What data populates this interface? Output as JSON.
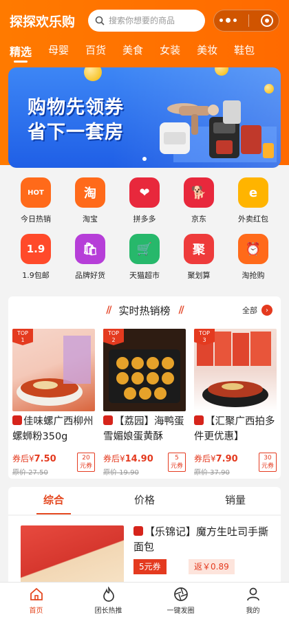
{
  "header": {
    "app_title": "探探欢乐购",
    "search_placeholder": "搜索你想要的商品",
    "tabs": [
      "精选",
      "母婴",
      "百货",
      "美食",
      "女装",
      "美妆",
      "鞋包"
    ],
    "active_tab": 0
  },
  "banner": {
    "line1": "购物先领券",
    "line2": "省下一套房"
  },
  "grid": [
    {
      "label": "今日热销",
      "icon": "hot-icon",
      "glyph": "HOT",
      "color": "#ff6a1a"
    },
    {
      "label": "淘宝",
      "icon": "taobao-icon",
      "glyph": "淘",
      "color": "#ff6a1a"
    },
    {
      "label": "拼多多",
      "icon": "pinduoduo-icon",
      "glyph": "❤",
      "color": "#e8283c"
    },
    {
      "label": "京东",
      "icon": "jd-icon",
      "glyph": "🐕",
      "color": "#e8283c"
    },
    {
      "label": "外卖红包",
      "icon": "takeout-icon",
      "glyph": "e",
      "color": "#ffb400"
    },
    {
      "label": "1.9包邮",
      "icon": "free-shipping-icon",
      "glyph": "1.9",
      "color": "#ff4a2a"
    },
    {
      "label": "品牌好货",
      "icon": "brand-bag-icon",
      "glyph": "🛍",
      "color": "#b63ed8"
    },
    {
      "label": "天猫超市",
      "icon": "tmall-market-icon",
      "glyph": "🛒",
      "color": "#27b86b"
    },
    {
      "label": "聚划算",
      "icon": "juhuasuan-icon",
      "glyph": "聚",
      "color": "#ee3b3b"
    },
    {
      "label": "淘抢购",
      "icon": "alarm-clock-icon",
      "glyph": "⏰",
      "color": "#ff6a1a"
    }
  ],
  "hot": {
    "title": "实时热销榜",
    "all_label": "全部",
    "items": [
      {
        "rank_text": "TOP",
        "rank": "1",
        "title": "佳味螺广西柳州螺蛳粉350g",
        "price_prefix": "券后¥",
        "price": "7.50",
        "old_price": "原价 27.50",
        "coupon_amount": "20",
        "coupon_unit": "元券",
        "img_colors": [
          "#f4c8b8",
          "#d9643c"
        ]
      },
      {
        "rank_text": "TOP",
        "rank": "2",
        "title": "【荔园】海鸭蛋雪媚娘蛋黄酥",
        "price_prefix": "券后¥",
        "price": "14.90",
        "old_price": "原价 19.90",
        "coupon_amount": "5",
        "coupon_unit": "元券",
        "img_colors": [
          "#3a2418",
          "#e4a12c"
        ]
      },
      {
        "rank_text": "TOP",
        "rank": "3",
        "title": "【汇聚广西拍多件更优惠】",
        "price_prefix": "券后¥",
        "price": "7.90",
        "old_price": "原价 37.90",
        "coupon_amount": "30",
        "coupon_unit": "元券",
        "img_colors": [
          "#f0d8d0",
          "#c23a2a"
        ]
      }
    ]
  },
  "sort_tabs": [
    "综合",
    "价格",
    "销量"
  ],
  "product": {
    "title": "【乐锦记】魔方生吐司手撕面包",
    "coupon": "5元券",
    "rebate": "返￥0.89"
  },
  "bottom_nav": [
    {
      "label": "首页",
      "icon": "home-icon"
    },
    {
      "label": "团长热推",
      "icon": "fire-icon"
    },
    {
      "label": "一键发圈",
      "icon": "shutter-icon"
    },
    {
      "label": "我的",
      "icon": "user-icon"
    }
  ],
  "colors": {
    "brand": "#ff6a00",
    "accent": "#e43a1f",
    "banner": "#2d72ee"
  }
}
